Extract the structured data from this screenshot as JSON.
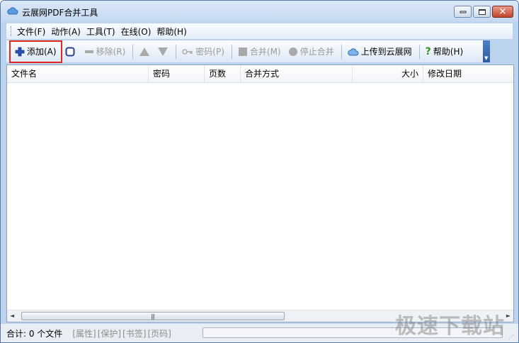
{
  "window": {
    "title": "云展网PDF合并工具"
  },
  "menu": {
    "items": [
      "文件(F)",
      "动作(A)",
      "工具(T)",
      "在线(O)",
      "帮助(H)"
    ]
  },
  "toolbar": {
    "add": "添加(A)",
    "remove": "移除(R)",
    "password": "密码(P)",
    "merge": "合并(M)",
    "stop_merge": "停止合并",
    "upload": "上传到云展网",
    "help": "帮助(H)"
  },
  "table": {
    "columns": [
      "文件名",
      "密码",
      "页数",
      "合并方式",
      "大小",
      "修改日期"
    ],
    "rows": []
  },
  "status": {
    "total": "合计:  0 个文件",
    "tags": [
      "[属性]",
      "[保护]",
      "[书签]",
      "[页码]"
    ],
    "progress": 0
  },
  "watermark": "极速下载站",
  "colors": {
    "accent": "#2f5b9d",
    "highlight": "#e0281e",
    "help_green": "#2f9a1e",
    "add_blue": "#2a4fb5"
  }
}
